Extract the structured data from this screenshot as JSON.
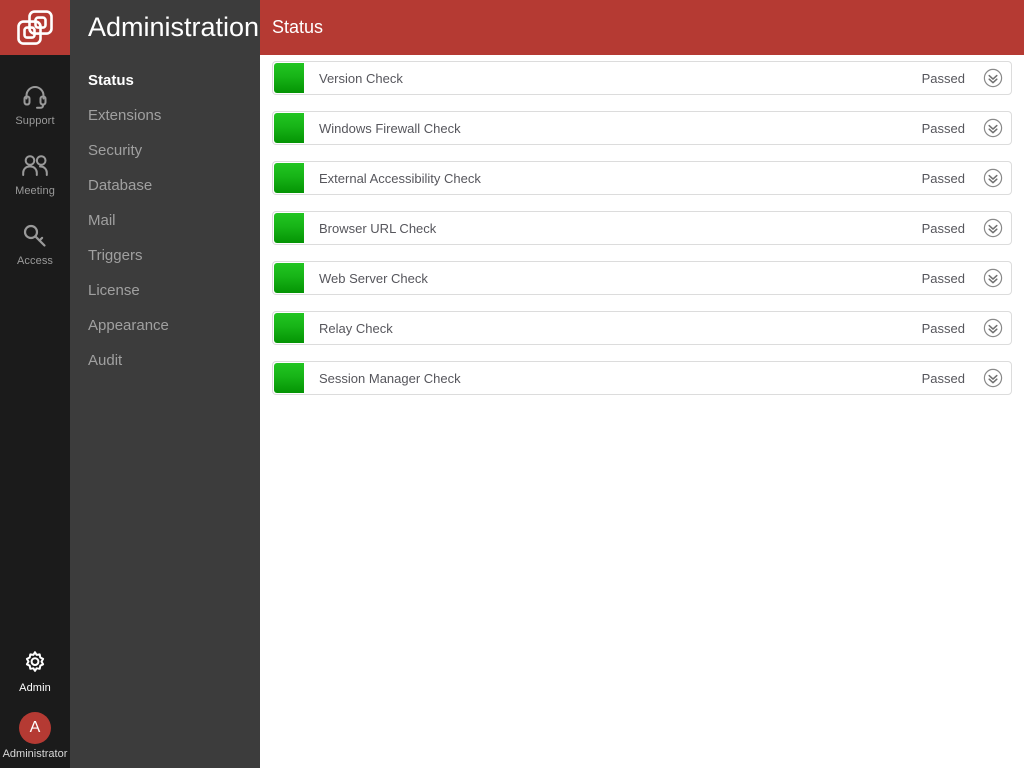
{
  "brand": {
    "logo_icon": "overlapping-squares-logo",
    "accent_color": "#b53a33"
  },
  "rail": {
    "items": [
      {
        "label": "Support",
        "icon": "headset-icon",
        "active": false
      },
      {
        "label": "Meeting",
        "icon": "people-icon",
        "active": false
      },
      {
        "label": "Access",
        "icon": "key-icon",
        "active": false
      }
    ],
    "bottom": {
      "admin": {
        "label": "Admin",
        "icon": "gear-icon",
        "active": true
      },
      "user": {
        "initial": "A",
        "name": "Administrator",
        "avatar_color": "#b53a33"
      }
    }
  },
  "sidebar": {
    "title": "Administration",
    "items": [
      {
        "label": "Status",
        "active": true
      },
      {
        "label": "Extensions",
        "active": false
      },
      {
        "label": "Security",
        "active": false
      },
      {
        "label": "Database",
        "active": false
      },
      {
        "label": "Mail",
        "active": false
      },
      {
        "label": "Triggers",
        "active": false
      },
      {
        "label": "License",
        "active": false
      },
      {
        "label": "Appearance",
        "active": false
      },
      {
        "label": "Audit",
        "active": false
      }
    ]
  },
  "header": {
    "title": "Status",
    "background_color": "#b53a33"
  },
  "checks": {
    "status_ok_color": "#17b417",
    "expand_icon": "chevron-double-down-icon",
    "rows": [
      {
        "name": "Version Check",
        "result": "Passed",
        "status": "ok"
      },
      {
        "name": "Windows Firewall Check",
        "result": "Passed",
        "status": "ok"
      },
      {
        "name": "External Accessibility Check",
        "result": "Passed",
        "status": "ok"
      },
      {
        "name": "Browser URL Check",
        "result": "Passed",
        "status": "ok"
      },
      {
        "name": "Web Server Check",
        "result": "Passed",
        "status": "ok"
      },
      {
        "name": "Relay Check",
        "result": "Passed",
        "status": "ok"
      },
      {
        "name": "Session Manager Check",
        "result": "Passed",
        "status": "ok"
      }
    ]
  }
}
